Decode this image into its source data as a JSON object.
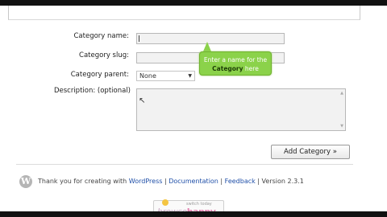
{
  "form": {
    "category_name_label": "Category name:",
    "category_slug_label": "Category slug:",
    "category_parent_label": "Category parent:",
    "description_label": "Description: (optional)",
    "category_name_value": "",
    "category_slug_value": "",
    "category_parent_value": "None",
    "description_value": ""
  },
  "tooltip": {
    "line1": "Enter a name for the",
    "line2_bold": "Category",
    "line2_rest": " here"
  },
  "buttons": {
    "add_category": "Add Category »"
  },
  "footer": {
    "thanks": "Thank you for creating with ",
    "wordpress_link": "WordPress",
    "sep1": " | ",
    "documentation_link": "Documentation",
    "sep2": " | ",
    "feedback_link": "Feedback",
    "sep3": " | ",
    "version": "Version 2.3.1"
  },
  "badge": {
    "small_text": "switch today",
    "logo_text_a": "browse",
    "logo_text_b": "happy"
  },
  "colors": {
    "tooltip_green": "#8bd24a",
    "link_blue": "#1f4fa8"
  }
}
